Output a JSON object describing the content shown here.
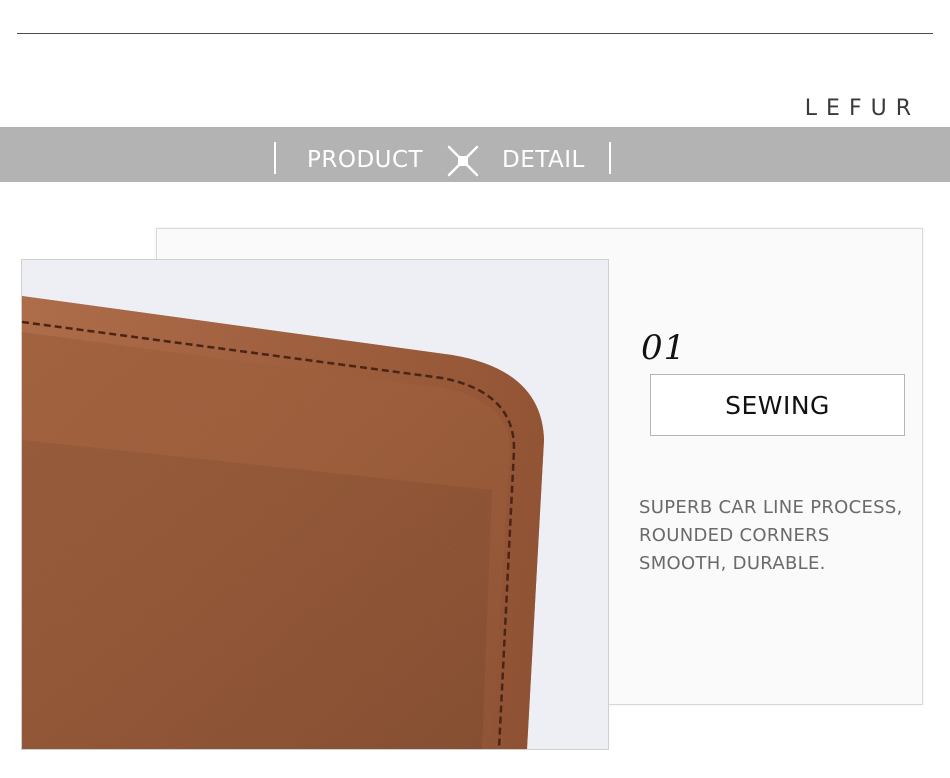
{
  "brand": {
    "name": "LEFUR"
  },
  "banner": {
    "left_word": "PRODUCT",
    "right_word": "DETAIL",
    "divider_icon": "cross-icon"
  },
  "feature": {
    "number": "01",
    "title": "SEWING",
    "description_lines": [
      "SUPERB CAR LINE PROCESS,",
      "ROUNDED CORNERS",
      "SMOOTH, DURABLE."
    ]
  },
  "photo": {
    "subject": "brown leather wallet corner with stitching"
  },
  "colors": {
    "banner_gray": "#b3b3b3",
    "leather_brown": "#9a5a38",
    "text_dark": "#111111",
    "text_muted": "#6a6a6a"
  }
}
